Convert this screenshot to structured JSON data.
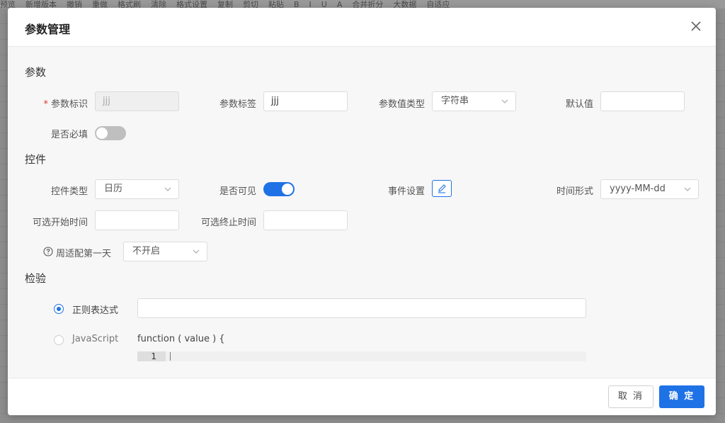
{
  "background": {
    "toolbar_items": [
      "预览",
      "新增版本",
      "撤销",
      "重做",
      "格式刷",
      "清除",
      "格式设置",
      "复制",
      "剪切",
      "粘贴",
      "B",
      "I",
      "U",
      "A",
      "合并折分",
      "大数据",
      "自适应"
    ]
  },
  "modal": {
    "title": "参数管理",
    "sections": {
      "params": "参数",
      "control": "控件",
      "validation": "检验"
    },
    "params": {
      "id_label": "参数标识",
      "id_value": "jjj",
      "tag_label": "参数标签",
      "tag_value": "jjj",
      "type_label": "参数值类型",
      "type_value": "字符串",
      "default_label": "默认值",
      "default_value": "",
      "required_label": "是否必填",
      "required_on": false
    },
    "control": {
      "type_label": "控件类型",
      "type_value": "日历",
      "visible_label": "是否可见",
      "visible_on": true,
      "event_label": "事件设置",
      "time_format_label": "时间形式",
      "time_format_value": "yyyy-MM-dd",
      "start_label": "可选开始时间",
      "start_value": "",
      "end_label": "可选终止时间",
      "end_value": "",
      "week_label": "周适配第一天",
      "week_value": "不开启"
    },
    "validation": {
      "regex_label": "正则表达式",
      "regex_value": "",
      "js_label": "JavaScript",
      "js_code": "function ( value ) {",
      "line_number": "1",
      "selected": "regex"
    },
    "footer": {
      "cancel": "取 消",
      "ok": "确 定"
    }
  },
  "colors": {
    "accent": "#1e72e6",
    "required": "#e0362c"
  },
  "icons": {
    "close": "close-icon",
    "edit": "edit-icon",
    "help": "question-circle-icon",
    "chevron": "chevron-down-icon"
  }
}
